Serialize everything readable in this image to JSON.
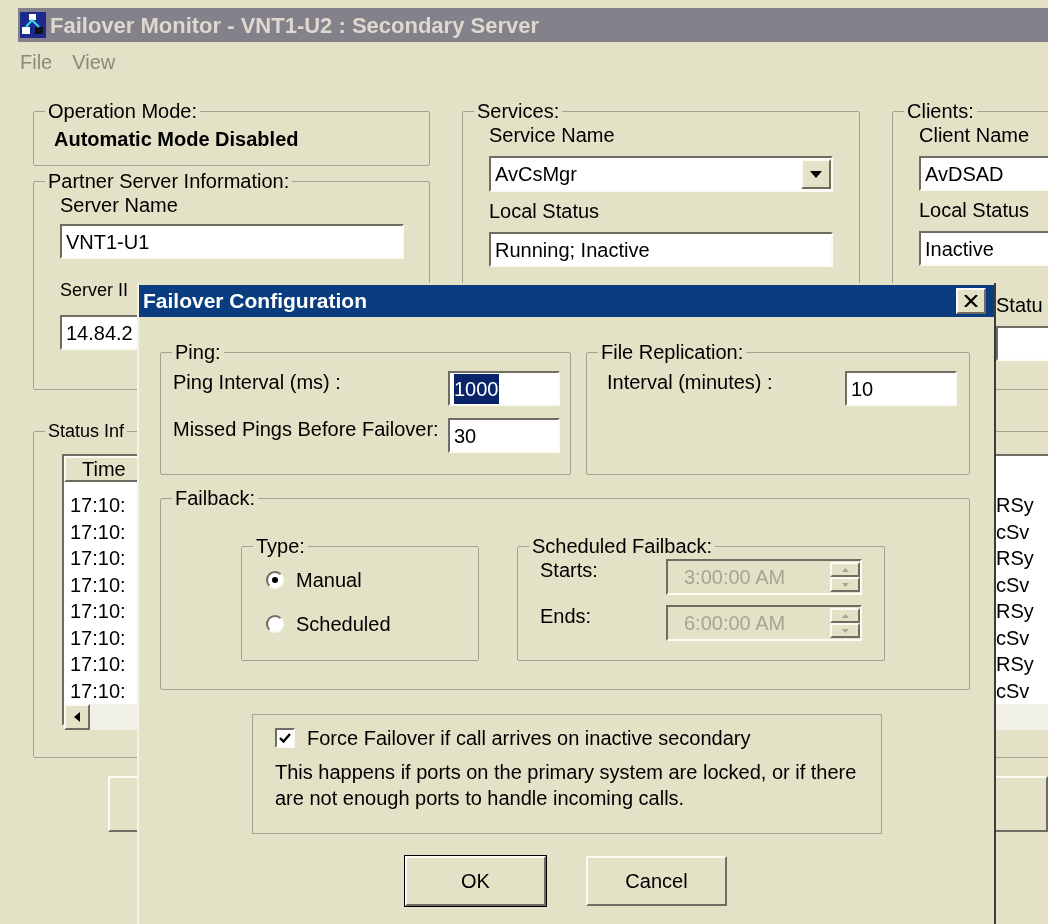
{
  "window": {
    "title": "Failover Monitor - VNT1-U2 : Secondary Server"
  },
  "menu": [
    {
      "label": "File",
      "disabled": true
    },
    {
      "label": "View",
      "disabled": true
    }
  ],
  "operation_mode": {
    "label": "Operation Mode:",
    "value": "Automatic Mode Disabled"
  },
  "partner": {
    "label": "Partner Server Information:",
    "server_name_label": "Server Name",
    "server_name": "VNT1-U1",
    "server_ip_label": "Server II",
    "server_ip": "14.84.2"
  },
  "services": {
    "label": "Services:",
    "service_name_label": "Service Name",
    "service_name": "AvCsMgr",
    "local_status_label": "Local Status",
    "local_status": "Running; Inactive"
  },
  "clients": {
    "label": "Clients:",
    "client_name_label": "Client Name",
    "client_name": "AvDSAD",
    "local_status_label": "Local Status",
    "local_status": "Inactive",
    "status_label": "Statu"
  },
  "status_info": {
    "label": "Status Inf",
    "columns": [
      "Time"
    ],
    "rows": [
      {
        "time": "17:10:",
        "column_2": "RSy"
      },
      {
        "time": "17:10:",
        "column_2": "cSv"
      },
      {
        "time": "17:10:",
        "column_2": "RSy"
      },
      {
        "time": "17:10:",
        "column_2": "cSv"
      },
      {
        "time": "17:10:",
        "column_2": "RSy"
      },
      {
        "time": "17:10:",
        "column_2": "cSv"
      },
      {
        "time": "17:10:",
        "column_2": "RSy"
      },
      {
        "time": "17:10:",
        "column_2": "cSv"
      }
    ]
  },
  "dialog": {
    "title": "Failover Configuration",
    "ping": {
      "label": "Ping:",
      "interval_label": "Ping Interval (ms) :",
      "interval": "1000",
      "interval_text_selected": true,
      "missed_label": "Missed Pings Before Failover:",
      "missed": "30"
    },
    "file_replication": {
      "label": "File Replication:",
      "interval_label": "Interval (minutes) :",
      "interval": "10"
    },
    "failback": {
      "label": "Failback:",
      "type": {
        "label": "Type:",
        "options": [
          {
            "label": "Manual",
            "selected": true
          },
          {
            "label": "Scheduled",
            "selected": false
          }
        ]
      },
      "scheduled": {
        "label": "Scheduled Failback:",
        "disabled": true,
        "starts_label": "Starts:",
        "starts": "3:00:00 AM",
        "ends_label": "Ends:",
        "ends": "6:00:00 AM"
      }
    },
    "force": {
      "label": "Force Failover if call arrives on inactive secondary",
      "checked": true,
      "note": "This happens if ports on the primary system are locked, or if there are not enough ports to handle incoming calls."
    },
    "buttons": [
      {
        "label": "OK",
        "default": true
      },
      {
        "label": "Cancel",
        "default": false
      }
    ]
  }
}
